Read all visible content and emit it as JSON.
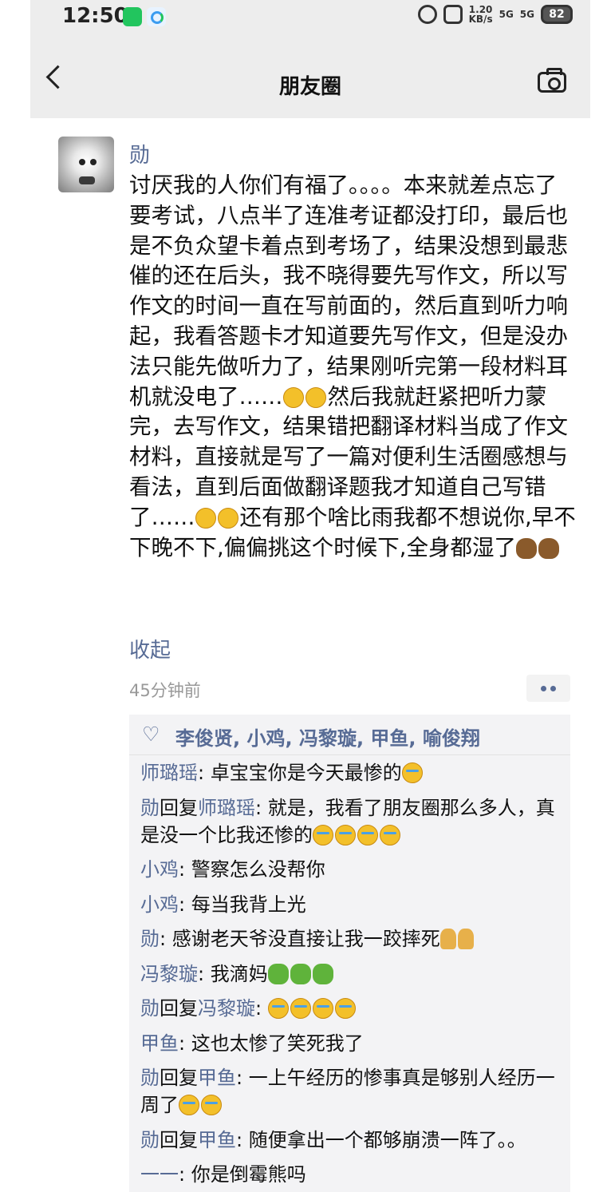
{
  "status_bar": {
    "time": "12:50",
    "speed_value": "1.20",
    "speed_unit": "KB/s",
    "signal_1": "5G",
    "signal_2": "5G",
    "battery": "82"
  },
  "nav": {
    "title": "朋友圈",
    "back_icon": "chevron-left-icon",
    "camera_icon": "camera-icon"
  },
  "post": {
    "author": "勋",
    "text_1": "讨厌我的人你们有福了。。。。本来就差点忘了要考试，八点半了连准考证都没打印，最后也是不负众望卡着点到考场了，结果没想到最悲催的还在后头，我不晓得要先写作文，所以写作文的时间一直在写前面的，然后直到听力响起，我看答题卡才知道要先写作文，但是没办法只能先做听力了，结果刚听完第一段材料耳机就没电了……",
    "text_2": "然后我就赶紧把听力蒙完，去写作文，结果错把翻译材料当成了作文材料，直接就是写了一篇对便利生活圈感想与看法，直到后面做翻译题我才知道自己写错了……",
    "text_3": "还有那个啥比雨我都不想说你,早不下晚不下,偏偏挑这个时候下,全身都湿了",
    "collapse_label": "收起",
    "time_ago": "45分钟前"
  },
  "likes": "李俊贤, 小鸡, 冯黎璇, 甲鱼, 喻俊翔",
  "comments": {
    "c1": {
      "name": "师璐瑶",
      "text": ": 卓宝宝你是今天最惨的"
    },
    "c2": {
      "name": "勋",
      "reply_word": "回复",
      "reply_to": "师璐瑶",
      "text": ": 就是，我看了朋友圈那么多人，真是没一个比我还惨的"
    },
    "c3": {
      "name": "小鸡",
      "text": ": 警察怎么没帮你"
    },
    "c4": {
      "name": "小鸡",
      "text": ": 每当我背上光"
    },
    "c5": {
      "name": "勋",
      "text": ": 感谢老天爷没直接让我一跤摔死"
    },
    "c6": {
      "name": "冯黎璇",
      "text": ": 我滴妈"
    },
    "c7": {
      "name": "勋",
      "reply_word": "回复",
      "reply_to": "冯黎璇",
      "text": ": "
    },
    "c8": {
      "name": "甲鱼",
      "text": ": 这也太惨了笑死我了"
    },
    "c9": {
      "name": "勋",
      "reply_word": "回复",
      "reply_to": "甲鱼",
      "text": ": 一上午经历的惨事真是够别人经历一周了"
    },
    "c10": {
      "name": "勋",
      "reply_word": "回复",
      "reply_to": "甲鱼",
      "text": ": 随便拿出一个都够崩溃一阵了。。"
    },
    "c11": {
      "name": "一一",
      "text": ": 你是倒霉熊吗"
    }
  }
}
